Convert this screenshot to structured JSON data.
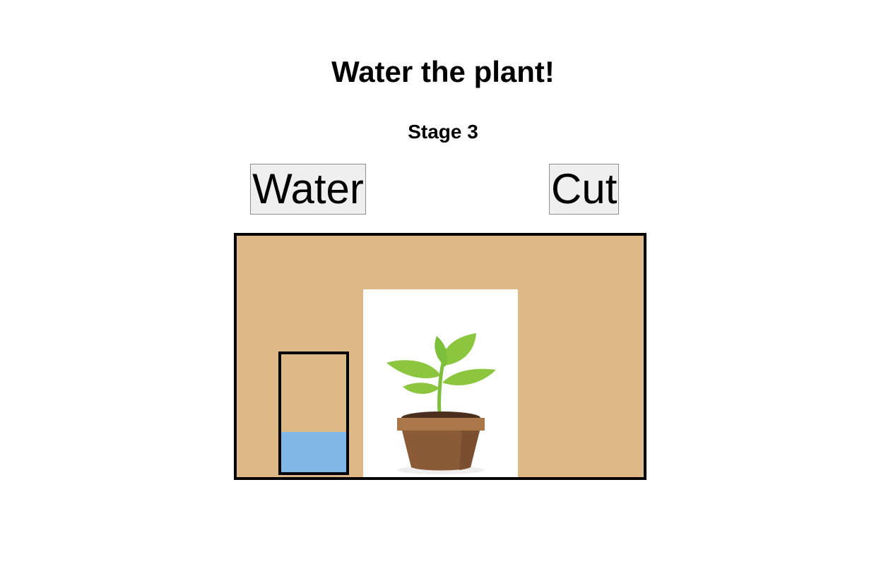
{
  "header": {
    "title": "Water the plant!",
    "stage_label": "Stage 3"
  },
  "controls": {
    "water_label": "Water",
    "cut_label": "Cut"
  },
  "scene": {
    "background_color": "#deb887",
    "glass_water_level": 0.34,
    "water_color": "#7fb8e8",
    "plant_icon": "potted-seedling-icon"
  }
}
